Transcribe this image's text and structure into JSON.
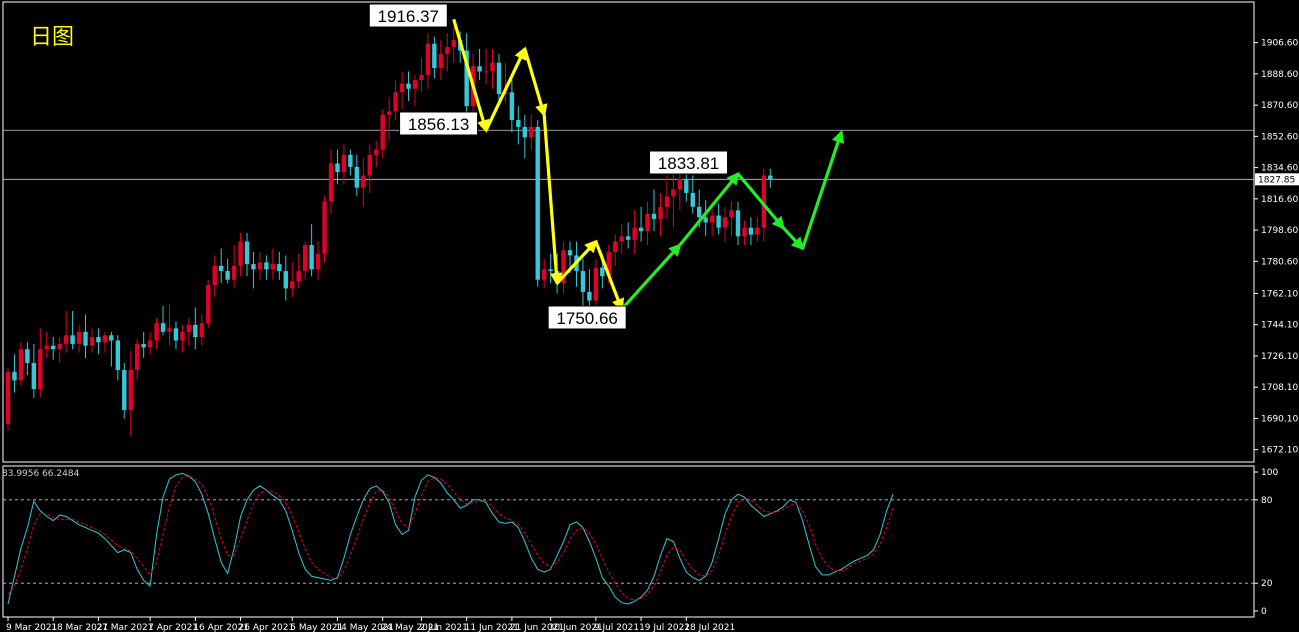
{
  "header": {
    "period_label": "日图",
    "indicator_values": "83.9956 66.2484"
  },
  "colors": {
    "background": "#000000",
    "bull": "#e0002a",
    "bear": "#36c8d8",
    "axis": "#ffffff",
    "hline": "#c8c8c8",
    "yellow_arrow": "#ffff10",
    "green_arrow": "#22ee22",
    "stoch_main": "#36c8d8",
    "stoch_signal": "#e0002a",
    "title": "#ffff00"
  },
  "chart_data": [
    {
      "type": "candlestick",
      "title": "",
      "ylim": [
        1665,
        1930
      ],
      "y_ticks": [
        "1906.60",
        "1888.60",
        "1870.60",
        "1852.60",
        "1834.60",
        "1816.60",
        "1798.60",
        "1780.60",
        "1762.10",
        "1744.10",
        "1726.10",
        "1708.10",
        "1690.10",
        "1672.10"
      ],
      "x_ticks": [
        "9 Mar 2021",
        "18 Mar 2021",
        "27 Mar 2021",
        "7 Apr 2021",
        "16 Apr 2021",
        "26 Apr 2021",
        "5 May 2021",
        "14 May 2021",
        "24 May 2021",
        "2 Jun 2021",
        "11 Jun 2021",
        "21 Jun 2021",
        "30 Jun 2021",
        "9 Jul 2021",
        "19 Jul 2021",
        "28 Jul 2021"
      ],
      "current_price": "1827.85",
      "horizontal_lines": [
        1856.13,
        1827.85
      ],
      "annotations": [
        {
          "label": "1916.37",
          "value": 1916.37
        },
        {
          "label": "1856.13",
          "value": 1856.13
        },
        {
          "label": "1750.66",
          "value": 1750.66
        },
        {
          "label": "1833.81",
          "value": 1833.81
        }
      ],
      "candles": [
        [
          1687,
          1719,
          1683,
          1717
        ],
        [
          1717,
          1727,
          1705,
          1712
        ],
        [
          1712,
          1734,
          1709,
          1730
        ],
        [
          1730,
          1734,
          1715,
          1722
        ],
        [
          1722,
          1733,
          1702,
          1707
        ],
        [
          1707,
          1742,
          1702,
          1730
        ],
        [
          1730,
          1740,
          1725,
          1732
        ],
        [
          1732,
          1737,
          1724,
          1730
        ],
        [
          1730,
          1737,
          1722,
          1733
        ],
        [
          1733,
          1752,
          1728,
          1738
        ],
        [
          1738,
          1752,
          1730,
          1733
        ],
        [
          1733,
          1744,
          1728,
          1740
        ],
        [
          1740,
          1750,
          1725,
          1732
        ],
        [
          1732,
          1742,
          1728,
          1737
        ],
        [
          1737,
          1742,
          1727,
          1734
        ],
        [
          1734,
          1740,
          1728,
          1738
        ],
        [
          1738,
          1740,
          1720,
          1735
        ],
        [
          1735,
          1738,
          1712,
          1718
        ],
        [
          1718,
          1722,
          1690,
          1695
        ],
        [
          1695,
          1729,
          1680,
          1718
        ],
        [
          1718,
          1736,
          1712,
          1733
        ],
        [
          1733,
          1740,
          1725,
          1731
        ],
        [
          1731,
          1740,
          1727,
          1735
        ],
        [
          1735,
          1748,
          1730,
          1745
        ],
        [
          1745,
          1755,
          1738,
          1740
        ],
        [
          1740,
          1756,
          1732,
          1742
        ],
        [
          1742,
          1746,
          1730,
          1735
        ],
        [
          1735,
          1744,
          1728,
          1740
        ],
        [
          1740,
          1748,
          1732,
          1744
        ],
        [
          1744,
          1754,
          1730,
          1737
        ],
        [
          1737,
          1750,
          1732,
          1745
        ],
        [
          1745,
          1770,
          1742,
          1767
        ],
        [
          1767,
          1784,
          1760,
          1778
        ],
        [
          1778,
          1788,
          1768,
          1775
        ],
        [
          1775,
          1782,
          1768,
          1770
        ],
        [
          1770,
          1790,
          1765,
          1778
        ],
        [
          1778,
          1797,
          1772,
          1792
        ],
        [
          1792,
          1797,
          1772,
          1779
        ],
        [
          1779,
          1786,
          1765,
          1776
        ],
        [
          1776,
          1786,
          1770,
          1780
        ],
        [
          1780,
          1784,
          1770,
          1776
        ],
        [
          1776,
          1788,
          1770,
          1779
        ],
        [
          1779,
          1786,
          1770,
          1775
        ],
        [
          1775,
          1784,
          1758,
          1765
        ],
        [
          1765,
          1780,
          1760,
          1769
        ],
        [
          1769,
          1785,
          1765,
          1775
        ],
        [
          1775,
          1792,
          1770,
          1790
        ],
        [
          1790,
          1802,
          1772,
          1776
        ],
        [
          1776,
          1792,
          1770,
          1785
        ],
        [
          1785,
          1818,
          1780,
          1815
        ],
        [
          1815,
          1845,
          1808,
          1837
        ],
        [
          1837,
          1845,
          1825,
          1832
        ],
        [
          1832,
          1848,
          1825,
          1842
        ],
        [
          1842,
          1845,
          1830,
          1835
        ],
        [
          1835,
          1842,
          1818,
          1823
        ],
        [
          1823,
          1840,
          1812,
          1830
        ],
        [
          1830,
          1848,
          1820,
          1842
        ],
        [
          1842,
          1850,
          1835,
          1845
        ],
        [
          1845,
          1868,
          1840,
          1865
        ],
        [
          1865,
          1875,
          1850,
          1867
        ],
        [
          1867,
          1885,
          1862,
          1878
        ],
        [
          1878,
          1890,
          1868,
          1883
        ],
        [
          1883,
          1890,
          1873,
          1880
        ],
        [
          1880,
          1888,
          1870,
          1885
        ],
        [
          1885,
          1898,
          1878,
          1888
        ],
        [
          1888,
          1912,
          1880,
          1906
        ],
        [
          1906,
          1910,
          1886,
          1892
        ],
        [
          1892,
          1908,
          1885,
          1900
        ],
        [
          1900,
          1912,
          1890,
          1904
        ],
        [
          1904,
          1916,
          1895,
          1908
        ],
        [
          1908,
          1913,
          1895,
          1902
        ],
        [
          1902,
          1912,
          1865,
          1870
        ],
        [
          1870,
          1900,
          1860,
          1893
        ],
        [
          1893,
          1903,
          1885,
          1890
        ],
        [
          1890,
          1903,
          1883,
          1890
        ],
        [
          1890,
          1903,
          1880,
          1895
        ],
        [
          1895,
          1900,
          1870,
          1877
        ],
        [
          1877,
          1895,
          1872,
          1878
        ],
        [
          1878,
          1888,
          1855,
          1862
        ],
        [
          1862,
          1870,
          1848,
          1858
        ],
        [
          1858,
          1865,
          1840,
          1852
        ],
        [
          1852,
          1865,
          1845,
          1858
        ],
        [
          1858,
          1862,
          1766,
          1770
        ],
        [
          1770,
          1782,
          1765,
          1776
        ],
        [
          1776,
          1785,
          1768,
          1775
        ],
        [
          1775,
          1785,
          1762,
          1768
        ],
        [
          1768,
          1792,
          1762,
          1787
        ],
        [
          1787,
          1792,
          1774,
          1784
        ],
        [
          1784,
          1792,
          1766,
          1775
        ],
        [
          1775,
          1782,
          1752,
          1763
        ],
        [
          1763,
          1776,
          1752,
          1758
        ],
        [
          1758,
          1782,
          1750,
          1777
        ],
        [
          1777,
          1785,
          1765,
          1772
        ],
        [
          1772,
          1790,
          1768,
          1786
        ],
        [
          1786,
          1796,
          1778,
          1792
        ],
        [
          1792,
          1802,
          1785,
          1795
        ],
        [
          1795,
          1803,
          1788,
          1793
        ],
        [
          1793,
          1810,
          1785,
          1800
        ],
        [
          1800,
          1812,
          1792,
          1798
        ],
        [
          1798,
          1815,
          1790,
          1808
        ],
        [
          1808,
          1822,
          1798,
          1805
        ],
        [
          1805,
          1820,
          1795,
          1812
        ],
        [
          1812,
          1830,
          1805,
          1818
        ],
        [
          1818,
          1835,
          1800,
          1822
        ],
        [
          1822,
          1834,
          1810,
          1828
        ],
        [
          1828,
          1834,
          1815,
          1820
        ],
        [
          1820,
          1830,
          1808,
          1812
        ],
        [
          1812,
          1822,
          1800,
          1806
        ],
        [
          1806,
          1816,
          1795,
          1803
        ],
        [
          1803,
          1812,
          1795,
          1807
        ],
        [
          1807,
          1814,
          1796,
          1800
        ],
        [
          1800,
          1812,
          1792,
          1806
        ],
        [
          1806,
          1815,
          1795,
          1810
        ],
        [
          1810,
          1815,
          1790,
          1795
        ],
        [
          1795,
          1804,
          1790,
          1800
        ],
        [
          1800,
          1806,
          1790,
          1796
        ],
        [
          1796,
          1806,
          1792,
          1800
        ],
        [
          1800,
          1834,
          1792,
          1830
        ],
        [
          1830,
          1834,
          1823,
          1828
        ]
      ]
    },
    {
      "type": "line",
      "title": "",
      "ylim": [
        0,
        100
      ],
      "y_ticks": [
        "100",
        "80",
        "20",
        "0"
      ],
      "levels": [
        80,
        20
      ],
      "series": [
        {
          "values": [
            5,
            25,
            45,
            60,
            79,
            72,
            68,
            65,
            69,
            68,
            65,
            62,
            60,
            58,
            56,
            52,
            47,
            42,
            44,
            42,
            30,
            22,
            18,
            55,
            82,
            95,
            98,
            99,
            97,
            93,
            84,
            70,
            52,
            35,
            27,
            45,
            68,
            80,
            87,
            90,
            87,
            83,
            80,
            72,
            58,
            42,
            30,
            25,
            24,
            23,
            22,
            24,
            38,
            55,
            68,
            80,
            88,
            90,
            86,
            78,
            62,
            55,
            58,
            82,
            94,
            98,
            96,
            92,
            85,
            80,
            74,
            76,
            80,
            80,
            78,
            70,
            64,
            63,
            64,
            60,
            50,
            38,
            30,
            28,
            30,
            40,
            50,
            62,
            64,
            60,
            50,
            38,
            24,
            18,
            10,
            6,
            5,
            7,
            10,
            15,
            25,
            40,
            52,
            50,
            38,
            28,
            24,
            22,
            25,
            35,
            52,
            70,
            80,
            84,
            82,
            76,
            72,
            68,
            70,
            72,
            75,
            80,
            78,
            65,
            48,
            32,
            26,
            26,
            28,
            30,
            33,
            36,
            38,
            40,
            44,
            55,
            72,
            84
          ]
        },
        {
          "values": [
            12,
            18,
            30,
            45,
            62,
            70,
            70,
            67,
            66,
            66,
            66,
            64,
            62,
            60,
            58,
            55,
            51,
            47,
            45,
            43,
            38,
            32,
            26,
            35,
            55,
            75,
            90,
            96,
            97,
            95,
            91,
            82,
            68,
            52,
            40,
            40,
            52,
            65,
            77,
            85,
            87,
            86,
            83,
            78,
            69,
            57,
            45,
            35,
            30,
            27,
            24,
            23,
            29,
            40,
            53,
            66,
            78,
            86,
            87,
            82,
            72,
            63,
            60,
            70,
            83,
            93,
            96,
            95,
            91,
            86,
            80,
            77,
            78,
            79,
            79,
            75,
            70,
            67,
            65,
            62,
            56,
            48,
            40,
            34,
            32,
            35,
            42,
            52,
            58,
            60,
            56,
            48,
            38,
            28,
            20,
            13,
            9,
            8,
            9,
            12,
            18,
            28,
            40,
            46,
            44,
            36,
            30,
            26,
            25,
            29,
            40,
            55,
            68,
            78,
            81,
            80,
            76,
            72,
            71,
            71,
            73,
            76,
            77,
            72,
            62,
            48,
            38,
            32,
            29,
            29,
            31,
            34,
            36,
            38,
            41,
            48,
            60,
            74
          ]
        }
      ]
    }
  ]
}
